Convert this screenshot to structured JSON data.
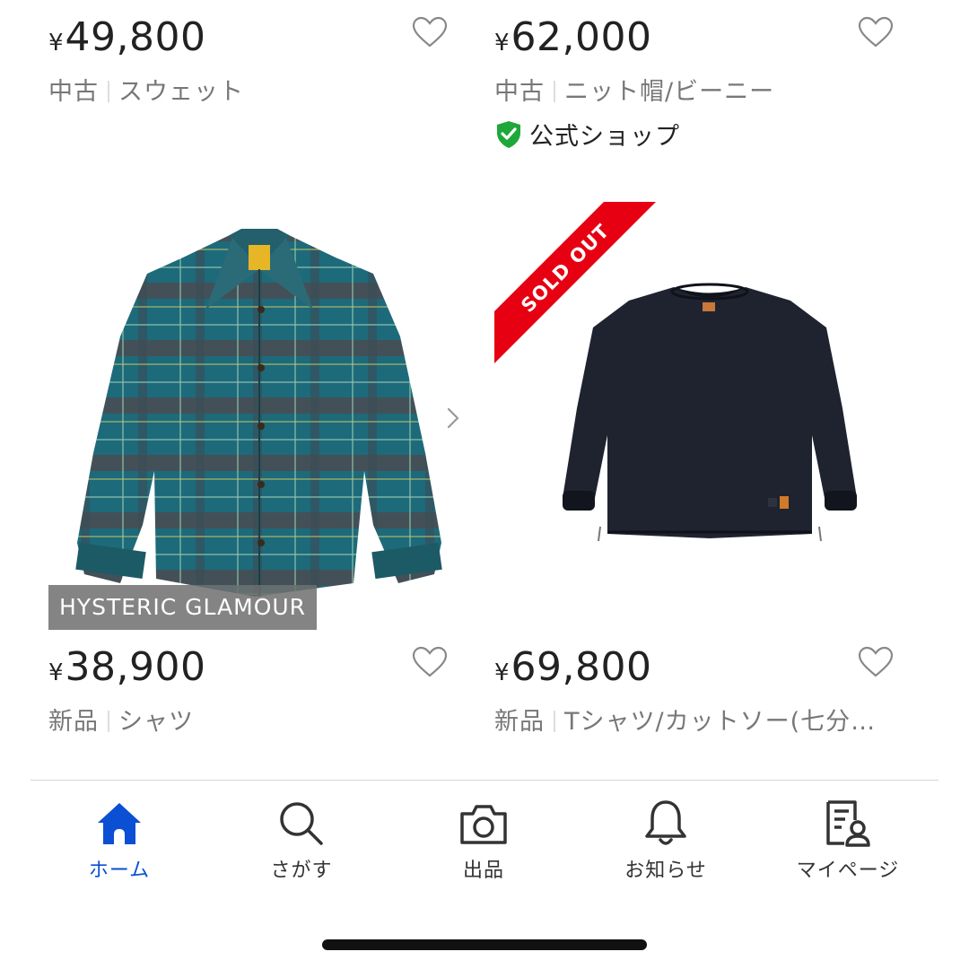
{
  "items": [
    {
      "yen": "¥",
      "price": "49,800",
      "condition": "中古",
      "category": "スウェット",
      "official_shop": null
    },
    {
      "yen": "¥",
      "price": "62,000",
      "condition": "中古",
      "category": "ニット帽/ビーニー",
      "official_shop": "公式ショップ"
    },
    {
      "yen": "¥",
      "price": "38,900",
      "condition": "新品",
      "category": "シャツ",
      "brand_tag": "HYSTERIC GLAMOUR",
      "image": "plaid-jacket"
    },
    {
      "yen": "¥",
      "price": "69,800",
      "condition": "新品",
      "category": "Tシャツ/カットソー(七分…",
      "sold_out": "SOLD OUT",
      "image": "black-pullover"
    }
  ],
  "nav": [
    {
      "label": "ホーム",
      "icon": "home-icon",
      "active": true
    },
    {
      "label": "さがす",
      "icon": "search-icon",
      "active": false
    },
    {
      "label": "出品",
      "icon": "camera-icon",
      "active": false
    },
    {
      "label": "お知らせ",
      "icon": "bell-icon",
      "active": false
    },
    {
      "label": "マイページ",
      "icon": "profile-doc-icon",
      "active": false
    }
  ],
  "colors": {
    "accent": "#0b4fd4",
    "sold_out_banner": "#e60012",
    "official_badge": "#1fa83a",
    "price_text": "#222222",
    "meta_text": "#777777"
  }
}
